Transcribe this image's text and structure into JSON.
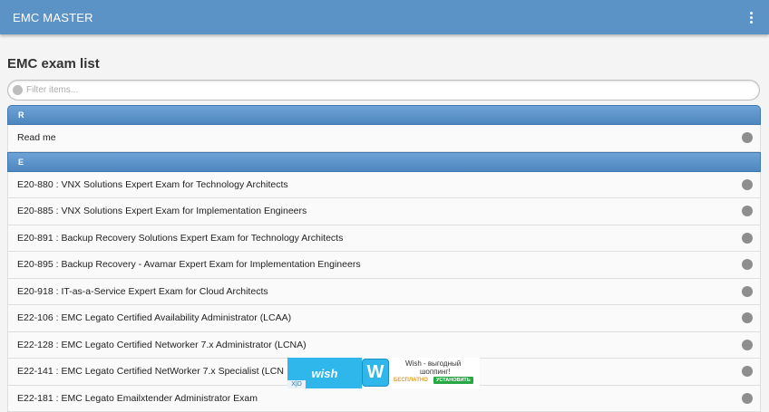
{
  "app": {
    "title": "EMC MASTER"
  },
  "page": {
    "title": "EMC exam list"
  },
  "filter": {
    "placeholder": "Filter items..."
  },
  "sections": [
    {
      "letter": "R",
      "items": [
        "Read me"
      ]
    },
    {
      "letter": "E",
      "items": [
        "E20-880 : VNX Solutions Expert Exam for Technology Architects",
        "E20-885 : VNX Solutions Expert Exam for Implementation Engineers",
        "E20-891 : Backup Recovery Solutions Expert Exam for Technology Architects",
        "E20-895 : Backup Recovery - Avamar Expert Exam for Implementation Engineers",
        "E20-918 : IT-as-a-Service Expert Exam for Cloud Architects",
        "E22-106 : EMC Legato Certified Availability Administrator (LCAA)",
        "E22-128 : EMC Legato Certified Networker 7.x Administrator (LCNA)",
        "E22-141 : EMC Legato Certified NetWorker 7.x Specialist (LCN",
        "E22-181 : EMC Legato Emailxtender Administrator Exam"
      ]
    }
  ],
  "ad": {
    "brand": "wish",
    "logo_letter": "W",
    "line1": "Wish - выгодный",
    "line2": "шоппинг!",
    "free_label": "БЕСПЛАТНО",
    "install_label": "УСТАНОВИТЬ",
    "close_label": "X|D"
  },
  "colors": {
    "appbar": "#5b93c6",
    "divider": "#5a93c9",
    "wish": "#2fb7ec"
  }
}
